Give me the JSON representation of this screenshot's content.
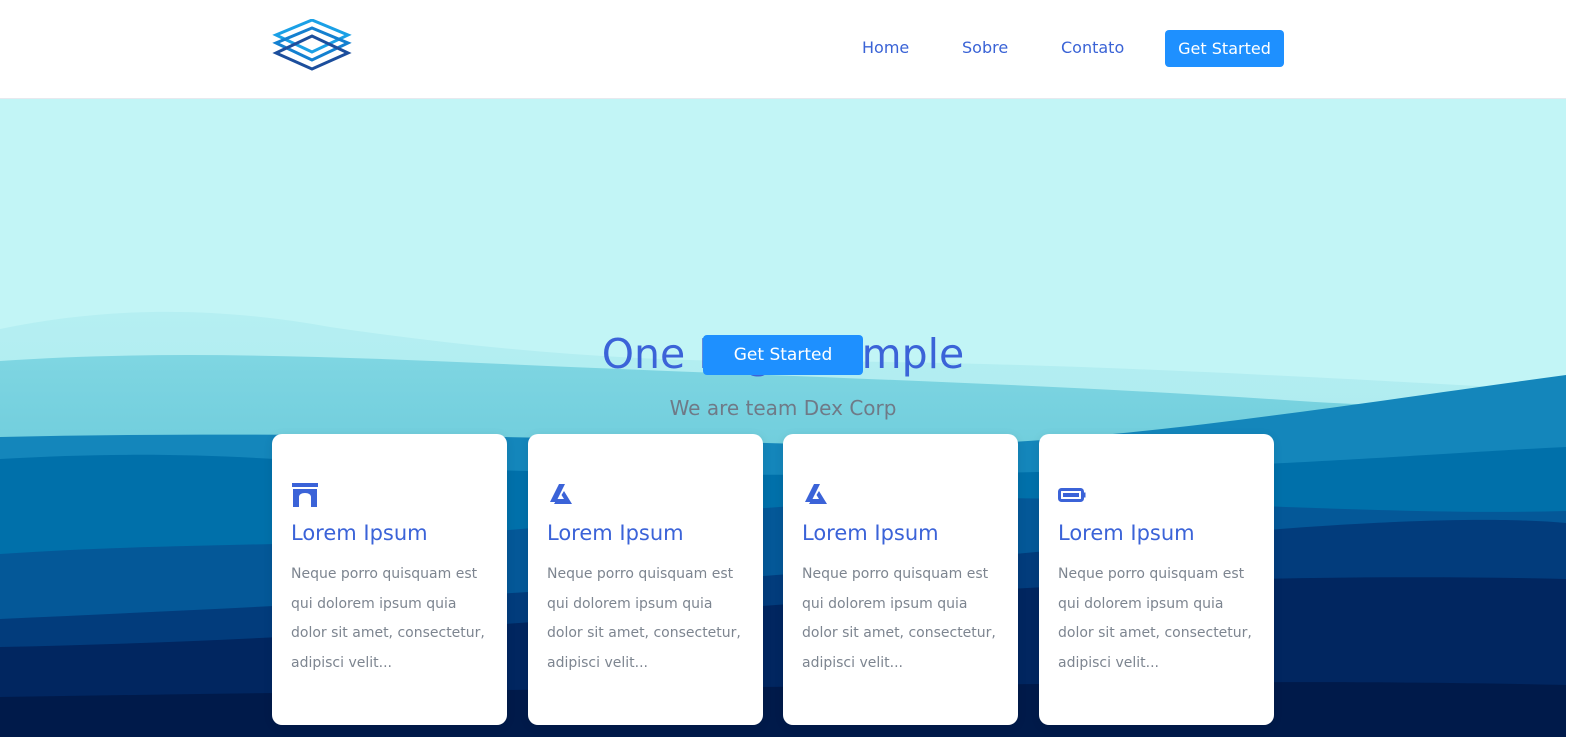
{
  "nav": {
    "logo_icon": "layered-diamond-logo-icon",
    "links": [
      "Home",
      "Sobre",
      "Contato"
    ],
    "cta_label": "Get Started"
  },
  "hero": {
    "title": "One Page Sample",
    "subtitle": "We are team Dex Corp",
    "cta_label": "Get Started"
  },
  "cards": [
    {
      "icon": "archway-icon",
      "title": "Lorem Ipsum",
      "text": "Neque porro quisquam est qui dolorem ipsum quia dolor sit amet, consectetur, adipisci velit..."
    },
    {
      "icon": "triangle-logo-icon",
      "title": "Lorem Ipsum",
      "text": "Neque porro quisquam est qui dolorem ipsum quia dolor sit amet, consectetur, adipisci velit..."
    },
    {
      "icon": "triangle-logo-icon",
      "title": "Lorem Ipsum",
      "text": "Neque porro quisquam est qui dolorem ipsum quia dolor sit amet, consectetur, adipisci velit..."
    },
    {
      "icon": "battery-icon",
      "title": "Lorem Ipsum",
      "text": "Neque porro quisquam est qui dolorem ipsum quia dolor sit amet, consectetur, adipisci velit..."
    }
  ],
  "colors": {
    "accent": "#1e90ff",
    "heading": "#3b63d8",
    "sky": "#c2f5f6",
    "mountain_light": "#0072ac",
    "mountain_dark": "#001a4a"
  }
}
